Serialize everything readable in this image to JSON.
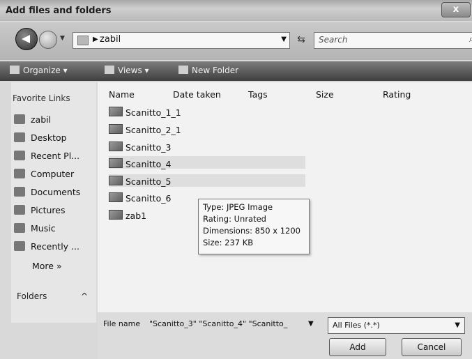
{
  "window": {
    "title": "Add files and folders",
    "close": "x"
  },
  "address": {
    "path": "zabil",
    "search_placeholder": "Search"
  },
  "toolbar": {
    "organize": "Organize",
    "views": "Views",
    "new_folder": "New Folder"
  },
  "favorites": {
    "heading": "Favorite Links",
    "items": [
      {
        "label": "zabil",
        "icon": "user-folder-icon"
      },
      {
        "label": "Desktop",
        "icon": "desktop-icon"
      },
      {
        "label": "Recent Pl...",
        "icon": "recent-places-icon"
      },
      {
        "label": "Computer",
        "icon": "computer-icon"
      },
      {
        "label": "Documents",
        "icon": "documents-icon"
      },
      {
        "label": "Pictures",
        "icon": "pictures-icon"
      },
      {
        "label": "Music",
        "icon": "music-icon"
      },
      {
        "label": "Recently ...",
        "icon": "recently-changed-icon"
      }
    ],
    "more": "More  »",
    "folders": "Folders",
    "folders_toggle": "^"
  },
  "columns": [
    "Name",
    "Date taken",
    "Tags",
    "Size",
    "Rating"
  ],
  "files": [
    {
      "name": "Scanitto_1_1"
    },
    {
      "name": "Scanitto_2_1"
    },
    {
      "name": "Scanitto_3"
    },
    {
      "name": "Scanitto_4"
    },
    {
      "name": "Scanitto_5"
    },
    {
      "name": "Scanitto_6"
    },
    {
      "name": "zab1"
    }
  ],
  "tooltip": {
    "type": "Type: JPEG Image",
    "rating": "Rating: Unrated",
    "dimensions": "Dimensions: 850 x 1200",
    "size": "Size: 237 KB"
  },
  "bottom": {
    "filename_label": "File name",
    "filename_value": "\"Scanitto_3\" \"Scanitto_4\" \"Scanitto_",
    "filter_value": "All Files (*.*)",
    "add": "Add",
    "cancel": "Cancel"
  }
}
